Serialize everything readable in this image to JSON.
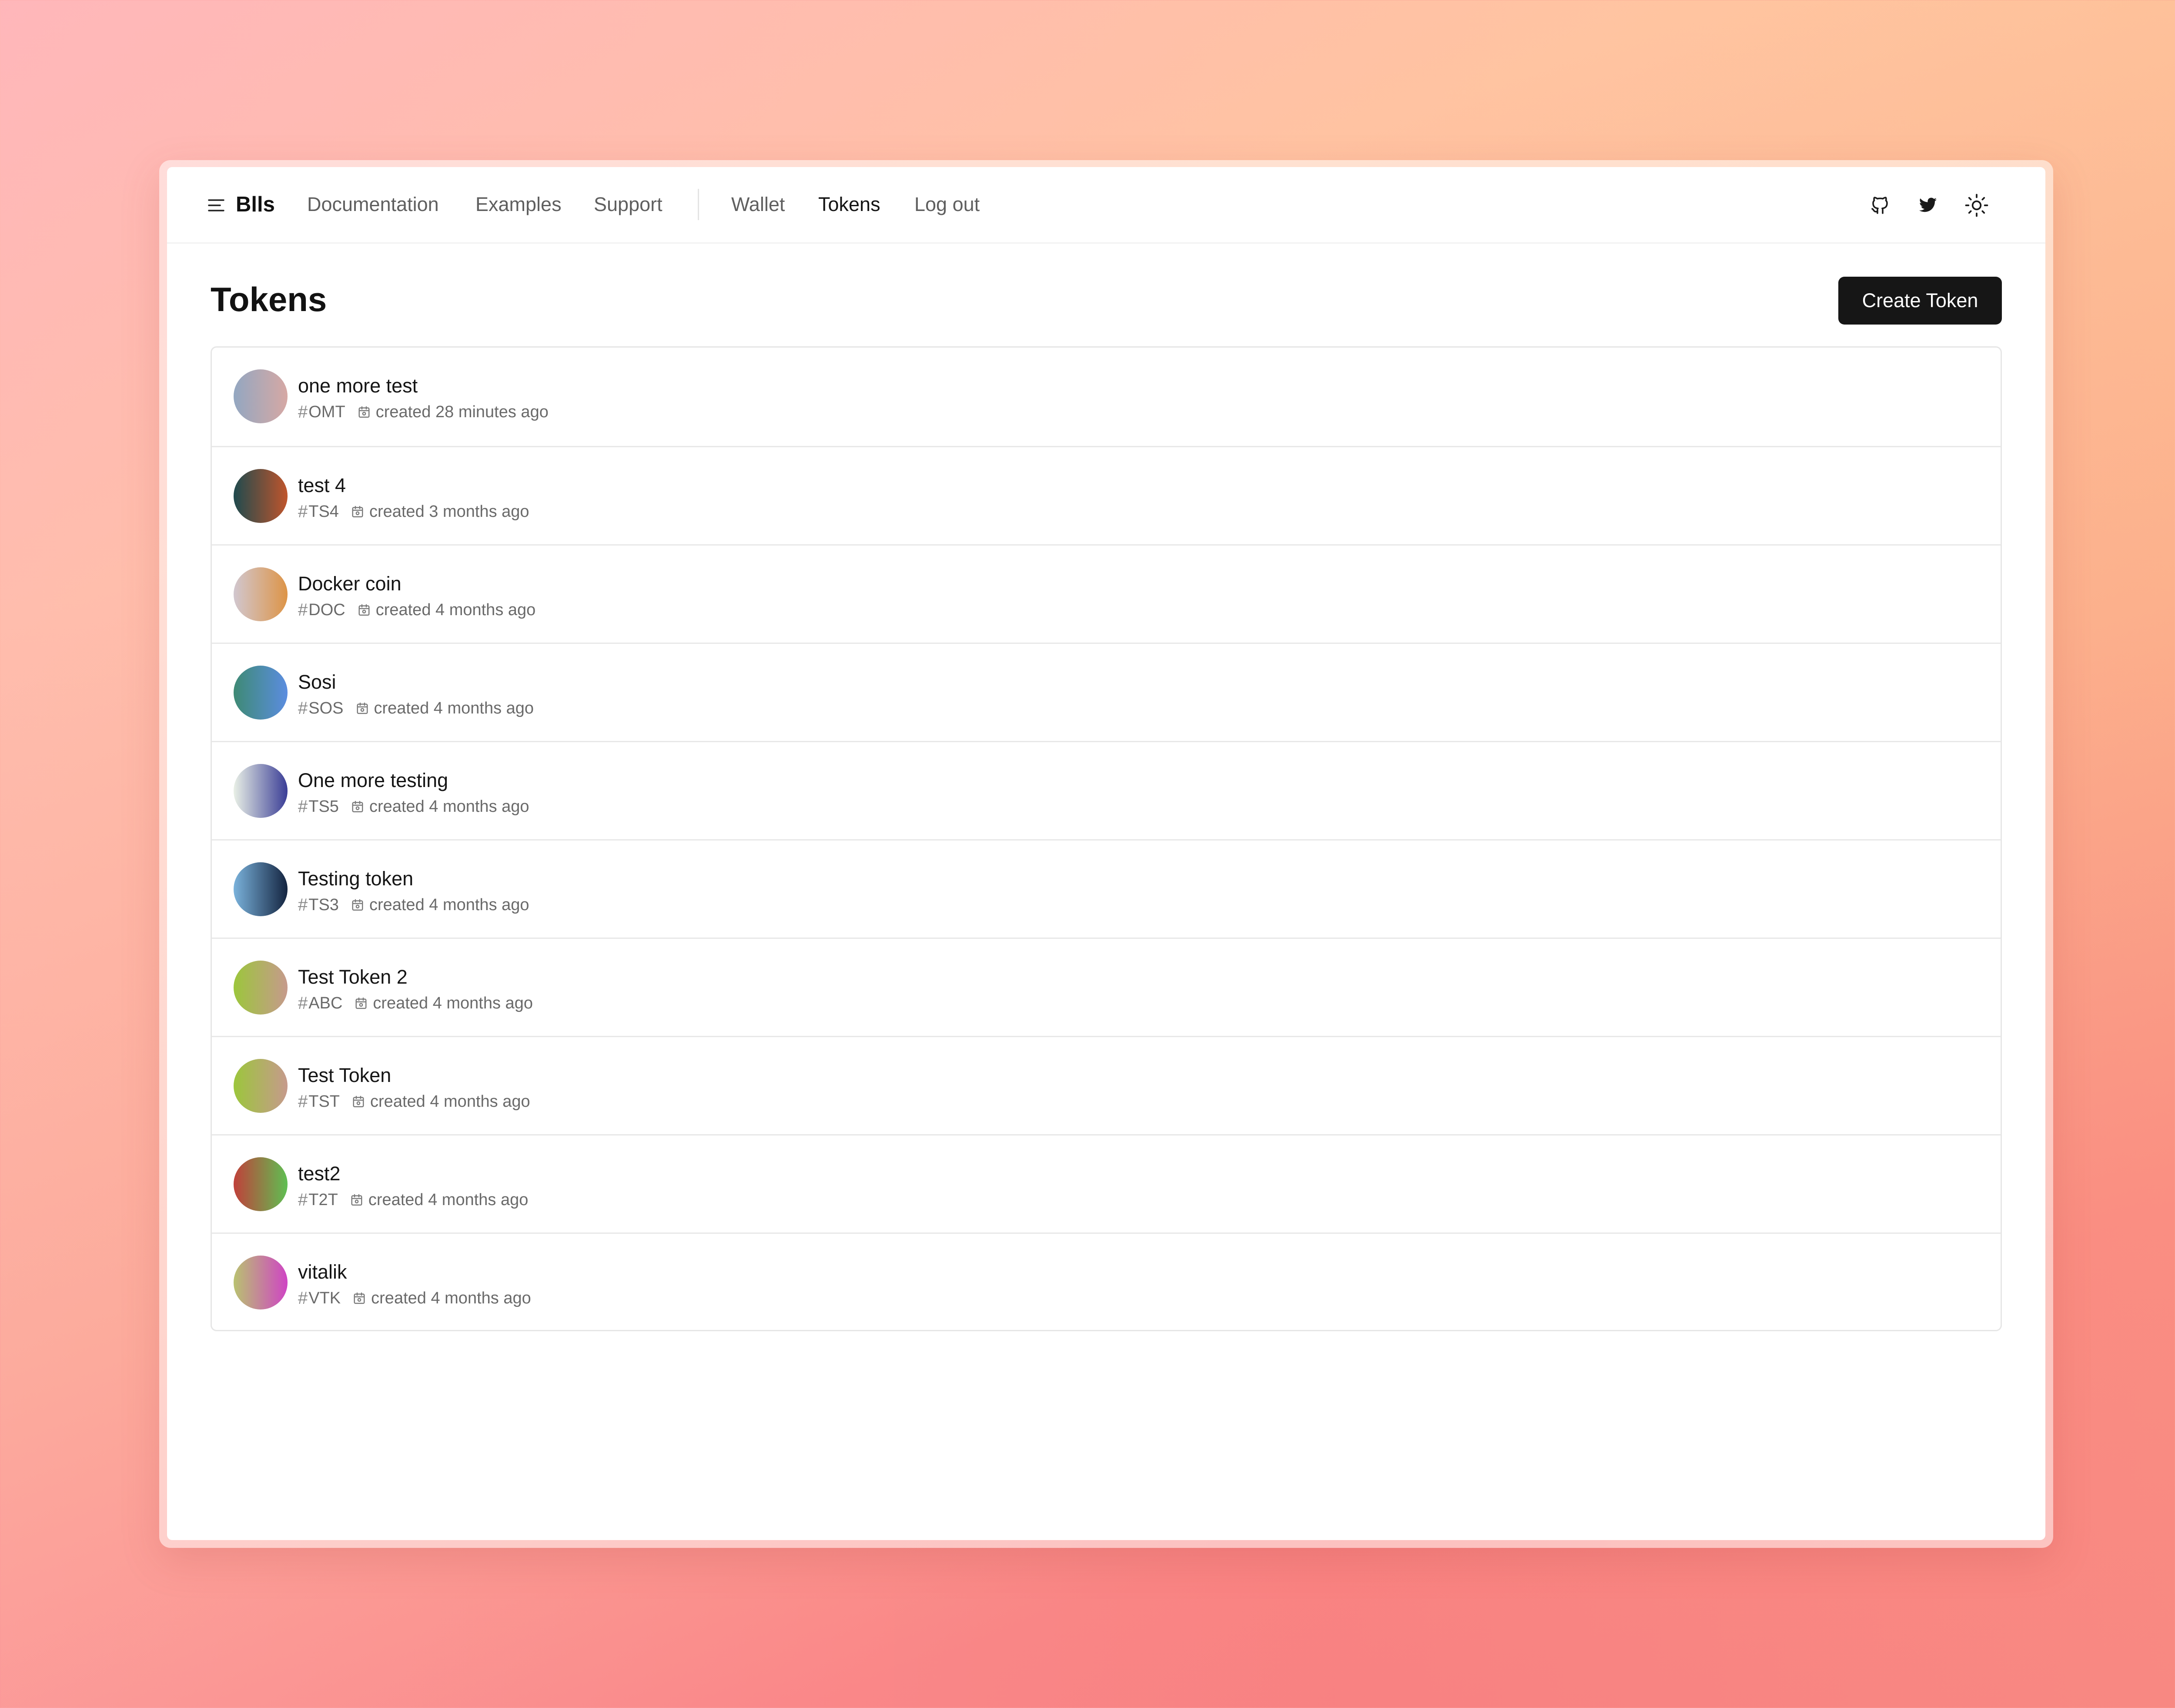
{
  "app": {
    "brand": "Blls"
  },
  "nav": {
    "links": [
      "Documentation",
      "Examples",
      "Support"
    ],
    "account_links": [
      "Wallet",
      "Tokens",
      "Log out"
    ],
    "active": "Tokens",
    "icons": [
      "github-icon",
      "twitter-icon",
      "sun-icon"
    ]
  },
  "page": {
    "title": "Tokens",
    "create_button": "Create Token"
  },
  "tokens": [
    {
      "name": "one more test",
      "symbol": "OMT",
      "created": "created 28 minutes ago",
      "colors": [
        "#93a7c1",
        "#d6a8a4"
      ]
    },
    {
      "name": "test 4",
      "symbol": "TS4",
      "created": "created 3 months ago",
      "colors": [
        "#1f4a4e",
        "#c0552c"
      ]
    },
    {
      "name": "Docker coin",
      "symbol": "DOC",
      "created": "created 4 months ago",
      "colors": [
        "#d1c7cf",
        "#dd9447"
      ]
    },
    {
      "name": "Sosi",
      "symbol": "SOS",
      "created": "created 4 months ago",
      "colors": [
        "#3e8a74",
        "#5b8de0"
      ]
    },
    {
      "name": "One more testing",
      "symbol": "TS5",
      "created": "created 4 months ago",
      "colors": [
        "#e9f0e6",
        "#3a3d96"
      ]
    },
    {
      "name": "Testing token",
      "symbol": "TS3",
      "created": "created 4 months ago",
      "colors": [
        "#7ab2db",
        "#142440"
      ]
    },
    {
      "name": "Test Token 2",
      "symbol": "ABC",
      "created": "created 4 months ago",
      "colors": [
        "#9cc63c",
        "#c69a8c"
      ]
    },
    {
      "name": "Test Token",
      "symbol": "TST",
      "created": "created 4 months ago",
      "colors": [
        "#9cc63c",
        "#c69a8c"
      ]
    },
    {
      "name": "test2",
      "symbol": "T2T",
      "created": "created 4 months ago",
      "colors": [
        "#c0403a",
        "#5fbf52"
      ]
    },
    {
      "name": "vitalik",
      "symbol": "VTK",
      "created": "created 4 months ago",
      "colors": [
        "#b9c270",
        "#cf44c4"
      ]
    }
  ]
}
